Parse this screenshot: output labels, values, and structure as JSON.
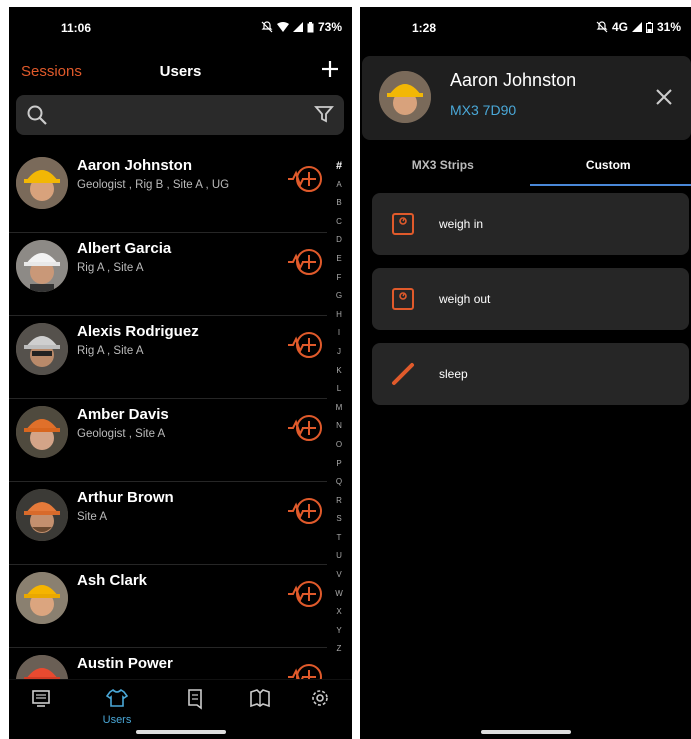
{
  "left": {
    "status": {
      "time": "11:06",
      "battery": "73%"
    },
    "header": {
      "sessions": "Sessions",
      "title": "Users"
    },
    "alphabet": [
      "#",
      "A",
      "B",
      "C",
      "D",
      "E",
      "F",
      "G",
      "H",
      "I",
      "J",
      "K",
      "L",
      "M",
      "N",
      "O",
      "P",
      "Q",
      "R",
      "S",
      "T",
      "U",
      "V",
      "W",
      "X",
      "Y",
      "Z"
    ],
    "users": [
      {
        "name": "Aaron Johnston",
        "info": "Geologist ,  Rig B ,  Site A ,  UG"
      },
      {
        "name": "Albert Garcia",
        "info": "Rig A ,  Site A"
      },
      {
        "name": "Alexis Rodriguez",
        "info": "Rig A ,  Site A"
      },
      {
        "name": "Amber Davis",
        "info": "Geologist ,  Site A"
      },
      {
        "name": "Arthur Brown",
        "info": "Site A"
      },
      {
        "name": "Ash Clark",
        "info": ""
      },
      {
        "name": "Austin Power",
        "info": ""
      }
    ],
    "nav": {
      "users_label": "Users"
    }
  },
  "right": {
    "status": {
      "time": "1:28",
      "network": "4G",
      "battery": "31%"
    },
    "detail": {
      "name": "Aaron Johnston",
      "device": "MX3 7D90"
    },
    "tabs": [
      "MX3 Strips",
      "Custom"
    ],
    "tasks": [
      {
        "label": "weigh in",
        "icon": "scale-icon"
      },
      {
        "label": "weigh out",
        "icon": "scale-icon"
      },
      {
        "label": "sleep",
        "icon": "pencil-icon"
      }
    ]
  },
  "colors": {
    "accent": "#e05a2b",
    "link": "#4aa8d8",
    "tab_indicator": "#4a88d8",
    "card": "#262626"
  }
}
